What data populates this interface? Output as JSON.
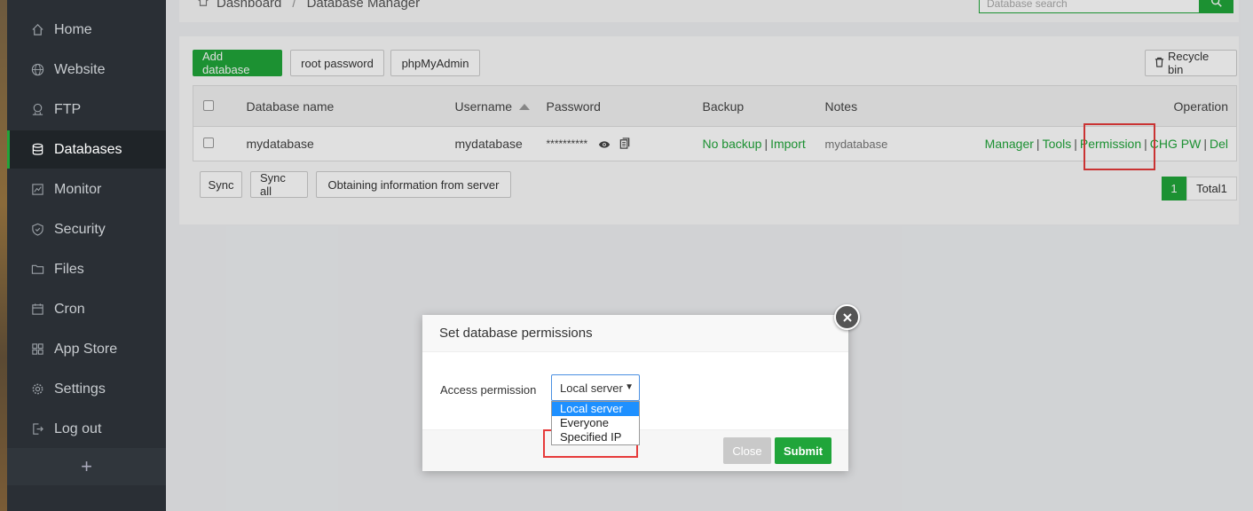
{
  "sidebar": {
    "items": [
      {
        "label": "Home",
        "icon": "home-icon"
      },
      {
        "label": "Website",
        "icon": "globe-icon"
      },
      {
        "label": "FTP",
        "icon": "ftp-icon"
      },
      {
        "label": "Databases",
        "icon": "database-icon"
      },
      {
        "label": "Monitor",
        "icon": "monitor-icon"
      },
      {
        "label": "Security",
        "icon": "shield-icon"
      },
      {
        "label": "Files",
        "icon": "folder-icon"
      },
      {
        "label": "Cron",
        "icon": "calendar-icon"
      },
      {
        "label": "App Store",
        "icon": "grid-icon"
      },
      {
        "label": "Settings",
        "icon": "gear-icon"
      },
      {
        "label": "Log out",
        "icon": "logout-icon"
      }
    ],
    "add_label": "+"
  },
  "breadcrumb": {
    "root": "Dashboard",
    "separator": "/",
    "current": "Database Manager"
  },
  "search": {
    "placeholder": "Database search"
  },
  "toolbar": {
    "add_database": "Add database",
    "root_password": "root password",
    "phpmyadmin": "phpMyAdmin",
    "recycle_bin": "Recycle bin"
  },
  "table": {
    "headers": {
      "name": "Database name",
      "username": "Username",
      "password": "Password",
      "backup": "Backup",
      "notes": "Notes",
      "operation": "Operation"
    },
    "rows": [
      {
        "name": "mydatabase",
        "username": "mydatabase",
        "password": "**********",
        "backup": "No backup",
        "import": "Import",
        "notes": "mydatabase",
        "ops": {
          "manager": "Manager",
          "tools": "Tools",
          "permission": "Permission",
          "chgpw": "CHG PW",
          "del": "Del"
        }
      }
    ]
  },
  "bottom": {
    "sync": "Sync",
    "sync_all": "Sync all",
    "obtain": "Obtaining information from server"
  },
  "pager": {
    "current": "1",
    "total": "Total1"
  },
  "modal": {
    "title": "Set database permissions",
    "field_label": "Access permission",
    "selected": "Local server",
    "options": [
      "Local server",
      "Everyone",
      "Specified IP"
    ],
    "close": "Close",
    "submit": "Submit"
  },
  "colors": {
    "accent": "#20a53a",
    "sidebar": "#2a2f35",
    "highlight": "#e63b3b",
    "option_selected": "#1e90ff"
  }
}
